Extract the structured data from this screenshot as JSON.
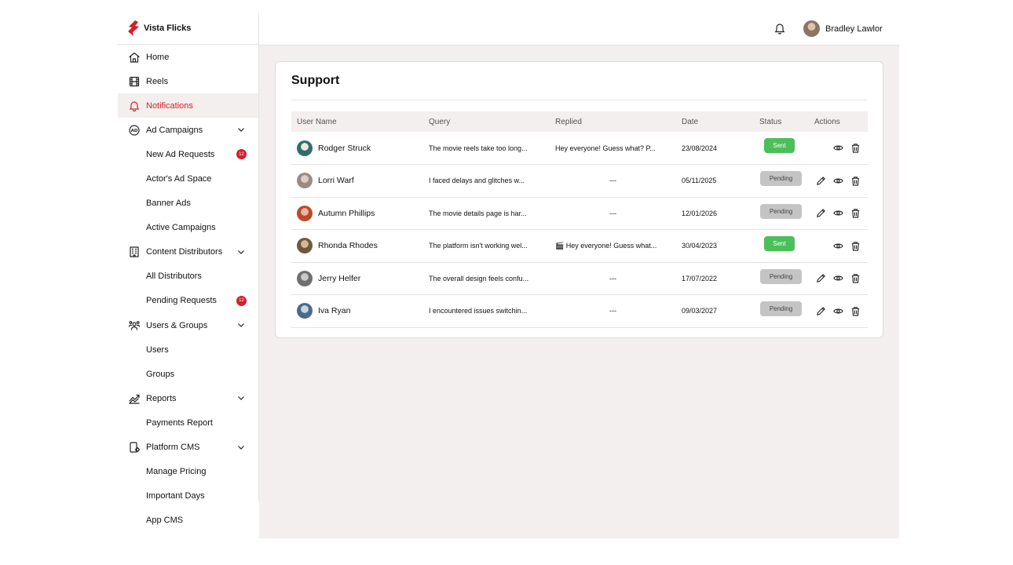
{
  "brand": {
    "name": "Vista Flicks",
    "logo_color": "#d41f2a"
  },
  "header": {
    "user_name": "Bradley Lawlor",
    "bell_icon": "bell-icon"
  },
  "sidebar": {
    "items": [
      {
        "label": "Home",
        "icon": "home-icon",
        "level": 0
      },
      {
        "label": "Reels",
        "icon": "film-icon",
        "level": 0
      },
      {
        "label": "Notifications",
        "icon": "bell-icon",
        "level": 0,
        "active": true
      },
      {
        "label": "Ad Campaigns",
        "icon": "ad-icon",
        "level": 0,
        "chevron": true
      },
      {
        "label": "New Ad Requests",
        "level": 1,
        "badge": "12"
      },
      {
        "label": "Actor's Ad Space",
        "level": 1
      },
      {
        "label": "Banner Ads",
        "level": 1
      },
      {
        "label": "Active Campaigns",
        "level": 1
      },
      {
        "label": "Content Distributors",
        "icon": "building-icon",
        "level": 0,
        "chevron": true
      },
      {
        "label": "All Distributors",
        "level": 1
      },
      {
        "label": "Pending Requests",
        "level": 1,
        "badge": "12"
      },
      {
        "label": "Users & Groups",
        "icon": "users-icon",
        "level": 0,
        "chevron": true
      },
      {
        "label": "Users",
        "level": 1
      },
      {
        "label": "Groups",
        "level": 1
      },
      {
        "label": "Reports",
        "icon": "chart-icon",
        "level": 0,
        "chevron": true
      },
      {
        "label": "Payments Report",
        "level": 1
      },
      {
        "label": "Platform CMS",
        "icon": "device-settings-icon",
        "level": 0,
        "chevron": true
      },
      {
        "label": "Manage Pricing",
        "level": 1
      },
      {
        "label": "Important Days",
        "level": 1
      },
      {
        "label": "App CMS",
        "level": 1
      }
    ]
  },
  "support": {
    "title": "Support",
    "columns": [
      "User Name",
      "Query",
      "Replied",
      "Date",
      "Status",
      "Actions"
    ],
    "rows": [
      {
        "user": "Rodger Struck",
        "query": "The movie reels take too long...",
        "replied": "Hey everyone! Guess what? P...",
        "date": "23/08/2024",
        "status": "Sent",
        "editable": false
      },
      {
        "user": "Lorri Warf",
        "query": "I faced delays and glitches w...",
        "replied": "---",
        "date": "05/11/2025",
        "status": "Pending",
        "editable": true
      },
      {
        "user": "Autumn Phillips",
        "query": "The movie details page is har...",
        "replied": "---",
        "date": "12/01/2026",
        "status": "Pending",
        "editable": true
      },
      {
        "user": "Rhonda Rhodes",
        "query": "The platform isn't working wel...",
        "replied": "🎬 Hey everyone! Guess what...",
        "date": "30/04/2023",
        "status": "Sent",
        "editable": false
      },
      {
        "user": "Jerry Helfer",
        "query": "The overall design feels confu...",
        "replied": "---",
        "date": "17/07/2022",
        "status": "Pending",
        "editable": true
      },
      {
        "user": "Iva Ryan",
        "query": "I encountered issues switchin...",
        "replied": "---",
        "date": "09/03/2027",
        "status": "Pending",
        "editable": true
      }
    ]
  },
  "colors": {
    "accent": "#d41f2a",
    "sent": "#4dbf5a",
    "pending": "#c4c4c4",
    "main_bg": "#f2efee"
  }
}
